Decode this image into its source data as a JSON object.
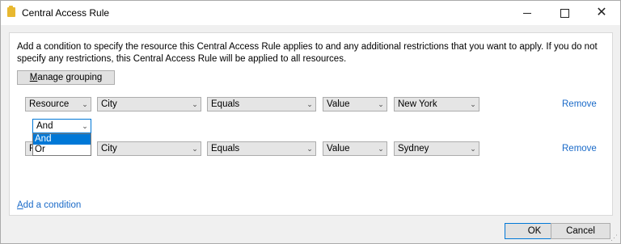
{
  "window": {
    "title": "Central Access Rule",
    "icon": "folder-icon",
    "controls": {
      "minimize": "minimize-icon",
      "maximize": "maximize-icon",
      "close": "close-icon"
    }
  },
  "description": "Add a condition to specify the resource this Central Access Rule applies to and any additional restrictions that you want to apply. If you do not specify any restrictions, this Central Access Rule will be applied to all resources.",
  "manage_grouping": {
    "mnemonic": "M",
    "rest": "anage grouping"
  },
  "conditions": [
    {
      "scope": "Resource",
      "attribute": "City",
      "operator": "Equals",
      "value_type": "Value",
      "value": "New York",
      "remove": "Remove"
    },
    {
      "scope": "R",
      "attribute": "City",
      "operator": "Equals",
      "value_type": "Value",
      "value": "Sydney",
      "remove": "Remove"
    }
  ],
  "connector": {
    "selected": "And",
    "options": [
      "And",
      "Or"
    ],
    "highlighted": "And"
  },
  "add_condition": {
    "mnemonic": "A",
    "rest": "dd a condition"
  },
  "footer": {
    "ok": "OK",
    "cancel": "Cancel"
  },
  "colors": {
    "accent": "#0078d7",
    "link": "#1a6ac8"
  }
}
